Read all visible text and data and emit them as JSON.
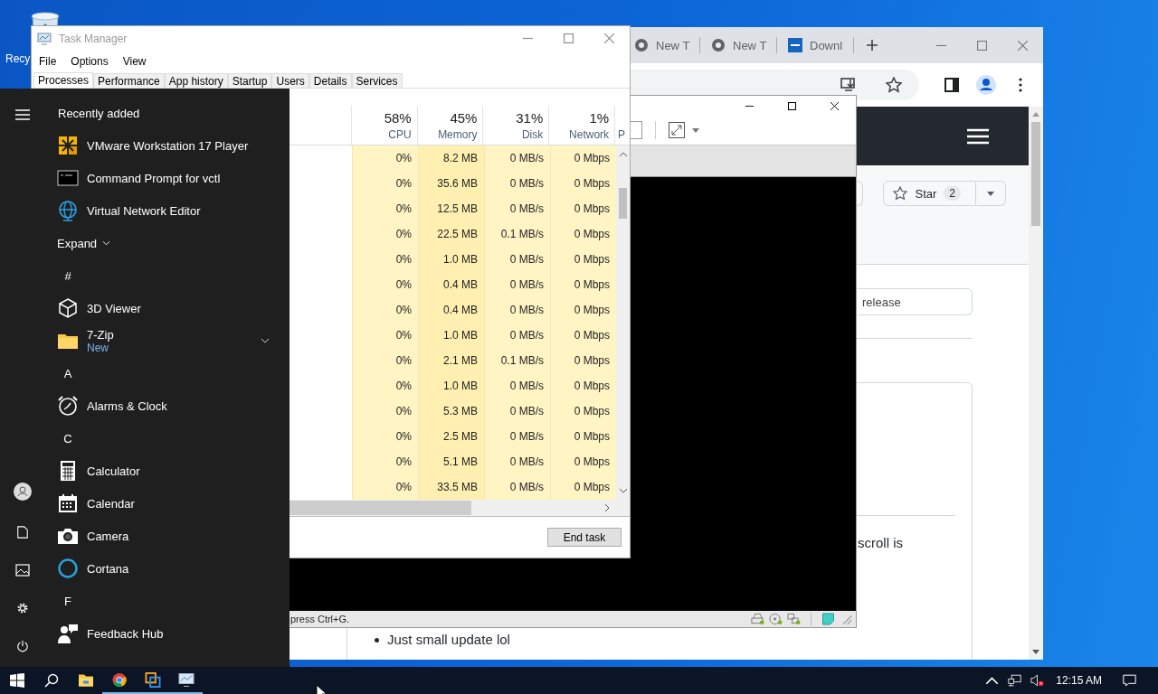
{
  "desktop": {
    "icons": [
      {
        "label": "Recy"
      }
    ]
  },
  "browser": {
    "tabs": [
      {
        "title": "New T"
      },
      {
        "title": "New T"
      },
      {
        "title": "Downl"
      }
    ],
    "star_button": {
      "label": "Star",
      "count": "2"
    },
    "release_field": {
      "value": "release"
    },
    "card_text": "scroll is",
    "bullets": [
      "Just small update lol"
    ]
  },
  "vm_player": {
    "status_text": "press Ctrl+G."
  },
  "task_manager": {
    "title": "Task Manager",
    "menu": [
      "File",
      "Options",
      "View"
    ],
    "tabs": [
      {
        "label": "Processes",
        "selected": true
      },
      {
        "label": "Performance",
        "selected": false
      },
      {
        "label": "App history",
        "selected": false
      },
      {
        "label": "Startup",
        "selected": false
      },
      {
        "label": "Users",
        "selected": false
      },
      {
        "label": "Details",
        "selected": false
      },
      {
        "label": "Services",
        "selected": false
      }
    ],
    "columns": [
      {
        "percent": "58%",
        "label": "CPU"
      },
      {
        "percent": "45%",
        "label": "Memory"
      },
      {
        "percent": "31%",
        "label": "Disk"
      },
      {
        "percent": "1%",
        "label": "Network"
      },
      {
        "label": "P"
      }
    ],
    "rows": [
      {
        "cpu": "0%",
        "memory": "8.2 MB",
        "disk": "0 MB/s",
        "network": "0 Mbps"
      },
      {
        "cpu": "0%",
        "memory": "35.6 MB",
        "disk": "0 MB/s",
        "network": "0 Mbps"
      },
      {
        "cpu": "0%",
        "memory": "12.5 MB",
        "disk": "0 MB/s",
        "network": "0 Mbps"
      },
      {
        "cpu": "0%",
        "memory": "22.5 MB",
        "disk": "0.1 MB/s",
        "network": "0 Mbps"
      },
      {
        "cpu": "0%",
        "memory": "1.0 MB",
        "disk": "0 MB/s",
        "network": "0 Mbps"
      },
      {
        "cpu": "0%",
        "memory": "0.4 MB",
        "disk": "0 MB/s",
        "network": "0 Mbps"
      },
      {
        "cpu": "0%",
        "memory": "0.4 MB",
        "disk": "0 MB/s",
        "network": "0 Mbps"
      },
      {
        "cpu": "0%",
        "memory": "1.0 MB",
        "disk": "0 MB/s",
        "network": "0 Mbps"
      },
      {
        "cpu": "0%",
        "memory": "2.1 MB",
        "disk": "0.1 MB/s",
        "network": "0 Mbps"
      },
      {
        "cpu": "0%",
        "memory": "1.0 MB",
        "disk": "0 MB/s",
        "network": "0 Mbps"
      },
      {
        "cpu": "0%",
        "memory": "5.3 MB",
        "disk": "0 MB/s",
        "network": "0 Mbps"
      },
      {
        "cpu": "0%",
        "memory": "2.5 MB",
        "disk": "0 MB/s",
        "network": "0 Mbps"
      },
      {
        "cpu": "0%",
        "memory": "5.1 MB",
        "disk": "0 MB/s",
        "network": "0 Mbps"
      },
      {
        "cpu": "0%",
        "memory": "33.5 MB",
        "disk": "0 MB/s",
        "network": "0 Mbps"
      }
    ],
    "end_task": "End task"
  },
  "start_menu": {
    "items": [
      {
        "kind": "header",
        "label": "Recently added"
      },
      {
        "kind": "app",
        "label": "VMware Workstation 17 Player"
      },
      {
        "kind": "app",
        "label": "Command Prompt for vctl"
      },
      {
        "kind": "app",
        "label": "Virtual Network Editor"
      },
      {
        "kind": "expand",
        "label": "Expand"
      },
      {
        "kind": "letter",
        "label": "#"
      },
      {
        "kind": "app",
        "label": "3D Viewer"
      },
      {
        "kind": "app",
        "label": "7-Zip",
        "badge": "New",
        "expandable": true
      },
      {
        "kind": "letter",
        "label": "A"
      },
      {
        "kind": "app",
        "label": "Alarms & Clock"
      },
      {
        "kind": "letter",
        "label": "C"
      },
      {
        "kind": "app",
        "label": "Calculator"
      },
      {
        "kind": "app",
        "label": "Calendar"
      },
      {
        "kind": "app",
        "label": "Camera"
      },
      {
        "kind": "app",
        "label": "Cortana"
      },
      {
        "kind": "letter",
        "label": "F"
      },
      {
        "kind": "app",
        "label": "Feedback Hub"
      }
    ]
  },
  "taskbar": {
    "apps": [
      {
        "running": false
      },
      {
        "running": true
      },
      {
        "running": true
      },
      {
        "running": true
      }
    ],
    "time": "12:15 AM"
  }
}
